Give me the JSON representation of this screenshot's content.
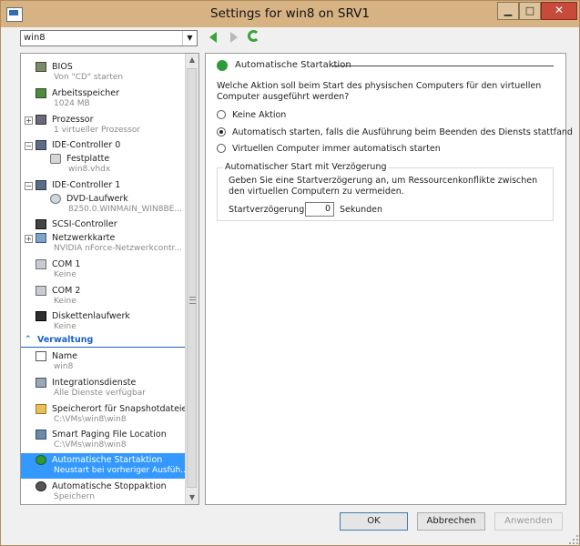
{
  "window": {
    "title": "Settings for win8 on SRV1"
  },
  "nav": {
    "vm_select_value": "win8"
  },
  "tree": {
    "hardware_items": [
      {
        "label": "BIOS",
        "sub": "Von \"CD\" starten",
        "icon": "bios-icon",
        "expand": ""
      },
      {
        "label": "Arbeitsspeicher",
        "sub": "1024 MB",
        "icon": "memory-icon",
        "expand": ""
      },
      {
        "label": "Prozessor",
        "sub": "1 virtueller Prozessor",
        "icon": "processor-icon",
        "expand": "+"
      },
      {
        "label": "IDE-Controller 0",
        "sub": "",
        "icon": "ide-controller-icon",
        "expand": "−"
      },
      {
        "label": "Festplatte",
        "sub": "win8.vhdx",
        "icon": "hard-disk-icon",
        "expand": ""
      },
      {
        "label": "IDE-Controller 1",
        "sub": "",
        "icon": "ide-controller-icon",
        "expand": "−"
      },
      {
        "label": "DVD-Laufwerk",
        "sub": "8250.0.WINMAIN_WIN8BE...",
        "icon": "dvd-drive-icon",
        "expand": ""
      },
      {
        "label": "SCSI-Controller",
        "sub": "",
        "icon": "scsi-controller-icon",
        "expand": ""
      },
      {
        "label": "Netzwerkkarte",
        "sub": "NVIDIA nForce-Netzwerkcontr...",
        "icon": "network-adapter-icon",
        "expand": "+"
      },
      {
        "label": "COM 1",
        "sub": "Keine",
        "icon": "com-port-icon",
        "expand": ""
      },
      {
        "label": "COM 2",
        "sub": "Keine",
        "icon": "com-port-icon",
        "expand": ""
      },
      {
        "label": "Diskettenlaufwerk",
        "sub": "Keine",
        "icon": "floppy-drive-icon",
        "expand": ""
      }
    ],
    "management_header": "Verwaltung",
    "management_items": [
      {
        "label": "Name",
        "sub": "win8",
        "icon": "name-icon"
      },
      {
        "label": "Integrationsdienste",
        "sub": "Alle Dienste verfügbar",
        "icon": "integration-services-icon"
      },
      {
        "label": "Speicherort für Snapshotdateien",
        "sub": "C:\\VMs\\win8\\win8",
        "icon": "snapshot-folder-icon"
      },
      {
        "label": "Smart Paging File Location",
        "sub": "C:\\VMs\\win8\\win8",
        "icon": "paging-file-icon"
      },
      {
        "label": "Automatische Startaktion",
        "sub": "Neustart bei vorheriger Ausfüh...",
        "icon": "auto-start-icon",
        "selected": true
      },
      {
        "label": "Automatische Stoppaktion",
        "sub": "Speichern",
        "icon": "auto-stop-icon"
      }
    ]
  },
  "content": {
    "section_title": "Automatische Startaktion",
    "question": "Welche Aktion soll beim Start des physischen Computers für den virtuellen Computer ausgeführt werden?",
    "options": [
      {
        "label": "Keine Aktion",
        "checked": false
      },
      {
        "label": "Automatisch starten, falls die Ausführung beim Beenden des Diensts stattfand",
        "checked": true
      },
      {
        "label": "Virtuellen Computer immer automatisch starten",
        "checked": false
      }
    ],
    "delay_group": {
      "title": "Automatischer Start mit Verzögerung",
      "description": "Geben Sie eine Startverzögerung an, um Ressourcenkonflikte zwischen den virtuellen Computern zu vermeiden.",
      "label": "Startverzögerung:",
      "value": "0",
      "unit": "Sekunden"
    }
  },
  "buttons": {
    "ok": "OK",
    "cancel": "Abbrechen",
    "apply": "Anwenden"
  }
}
